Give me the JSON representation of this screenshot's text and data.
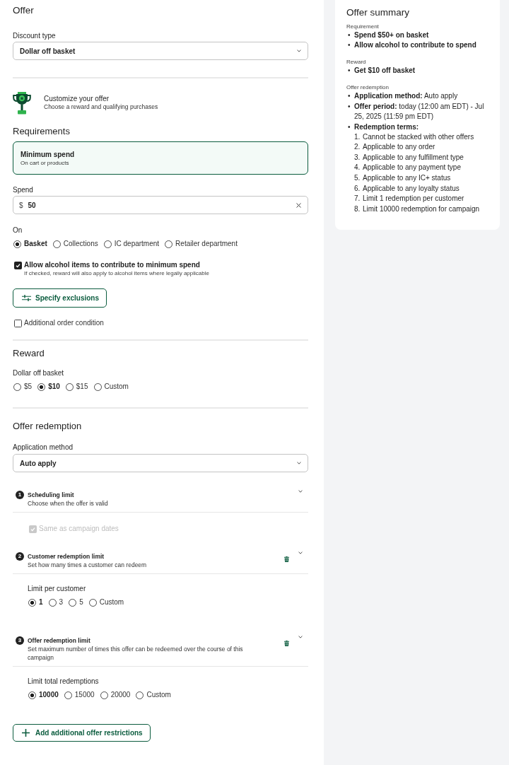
{
  "offer": {
    "title": "Offer",
    "discount_type": {
      "label": "Discount type",
      "value": "Dollar off basket"
    }
  },
  "customize": {
    "title": "Customize your offer",
    "subtitle": "Choose a reward and qualifying purchases"
  },
  "requirements": {
    "title": "Requirements",
    "card": {
      "title": "Minimum spend",
      "subtitle": "On cart or products",
      "selected": true
    },
    "spend": {
      "label": "Spend",
      "prefix": "$",
      "value": "50"
    },
    "on": {
      "label": "On",
      "options": [
        {
          "label": "Basket",
          "selected": true
        },
        {
          "label": "Collections",
          "selected": false
        },
        {
          "label": "IC department",
          "selected": false
        },
        {
          "label": "Retailer department",
          "selected": false
        }
      ]
    },
    "alcohol": {
      "label": "Allow alcohol items to contribute to minimum spend",
      "hint": "If checked, reward will also apply to alcohol items where legally applicable",
      "checked": true
    },
    "exclusions_button": "Specify exclusions",
    "additional_condition": {
      "label": "Additional order condition",
      "checked": false
    }
  },
  "reward": {
    "title": "Reward",
    "label": "Dollar off basket",
    "options": [
      {
        "label": "$5",
        "selected": false
      },
      {
        "label": "$10",
        "selected": true
      },
      {
        "label": "$15",
        "selected": false
      },
      {
        "label": "Custom",
        "selected": false
      }
    ]
  },
  "redemption": {
    "title": "Offer redemption",
    "application_method": {
      "label": "Application method",
      "value": "Auto apply"
    },
    "limits": [
      {
        "number": "1",
        "title": "Scheduling limit",
        "subtitle": "Choose when the offer is valid",
        "deletable": false,
        "body": {
          "kind": "checkbox",
          "label": "Same as campaign dates",
          "checked": true,
          "disabled": true
        }
      },
      {
        "number": "2",
        "title": "Customer redemption limit",
        "subtitle": "Set how many times a customer can redeem",
        "deletable": true,
        "body": {
          "kind": "radios",
          "label": "Limit per customer",
          "options": [
            {
              "label": "1",
              "selected": true
            },
            {
              "label": "3",
              "selected": false
            },
            {
              "label": "5",
              "selected": false
            },
            {
              "label": "Custom",
              "selected": false
            }
          ]
        }
      },
      {
        "number": "3",
        "title": "Offer redemption limit",
        "subtitle": "Set maximum number of times this offer can be redeemed over the course of this campaign",
        "deletable": true,
        "body": {
          "kind": "radios",
          "label": "Limit total redemptions",
          "options": [
            {
              "label": "10000",
              "selected": true
            },
            {
              "label": "15000",
              "selected": false
            },
            {
              "label": "20000",
              "selected": false
            },
            {
              "label": "Custom",
              "selected": false
            }
          ]
        }
      }
    ],
    "add_button": "Add additional offer restrictions"
  },
  "summary": {
    "title": "Offer summary",
    "sections": [
      {
        "heading": "Requirement",
        "items": [
          {
            "bullet": "•",
            "label": "Spend $50+ on basket"
          },
          {
            "bullet": "•",
            "label": "Allow alcohol to contribute to spend"
          }
        ]
      },
      {
        "heading": "Reward",
        "items": [
          {
            "bullet": "•",
            "label": "Get $10 off basket"
          }
        ]
      },
      {
        "heading": "Offer redemption",
        "items": [
          {
            "bullet": "•",
            "label": "Application method:",
            "value": "Auto apply"
          },
          {
            "bullet": "•",
            "label": "Offer period:",
            "value": "today (12:00 am EDT) - Jul 25, 2025 (11:59 pm EDT)"
          },
          {
            "bullet": "•",
            "label": "Redemption terms:",
            "terms": [
              {
                "number": "1.",
                "text": "Cannot be stacked with other offers"
              },
              {
                "number": "2.",
                "text": "Applicable to any order"
              },
              {
                "number": "3.",
                "text": "Applicable to any fulfillment type"
              },
              {
                "number": "4.",
                "text": "Applicable to any payment type"
              },
              {
                "number": "5.",
                "text": "Applicable to any IC+ status"
              },
              {
                "number": "6.",
                "text": "Applicable to any loyalty status"
              },
              {
                "number": "7.",
                "text": "Limit 1 redemption per customer"
              },
              {
                "number": "8.",
                "text": "Limit 10000 redemption for campaign"
              }
            ]
          }
        ]
      }
    ]
  }
}
